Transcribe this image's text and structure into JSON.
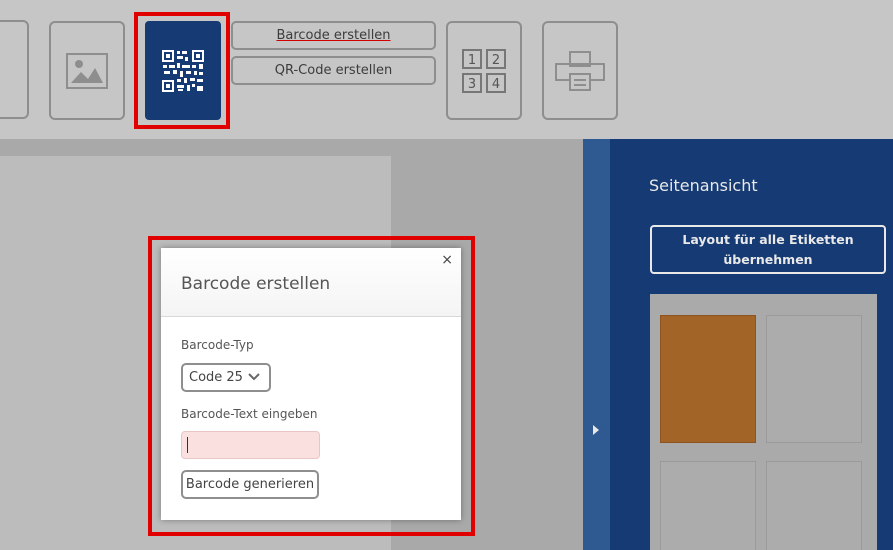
{
  "toolbar": {
    "barcode_button_label": "Barcode erstellen",
    "qr_button_label": "QR-Code erstellen",
    "grid_numbers": [
      "1",
      "2",
      "3",
      "4"
    ],
    "icons": [
      "circle-icon",
      "image-icon",
      "qr-code-icon",
      "grid-numbers-icon",
      "print-icon"
    ]
  },
  "side_panel": {
    "title": "Seitenansicht",
    "layout_button_line1": "Layout für alle Etiketten",
    "layout_button_line2": "übernehmen"
  },
  "dialog": {
    "title": "Barcode erstellen",
    "close_symbol": "×",
    "type_label": "Barcode-Typ",
    "type_value": "Code 25",
    "text_label": "Barcode-Text eingeben",
    "text_value": "",
    "generate_label": "Barcode generieren"
  },
  "colors": {
    "accent_blue": "#163a73",
    "highlight_red": "#e00000",
    "active_label": "#a36428",
    "input_error_bg": "#fbe0e0"
  }
}
